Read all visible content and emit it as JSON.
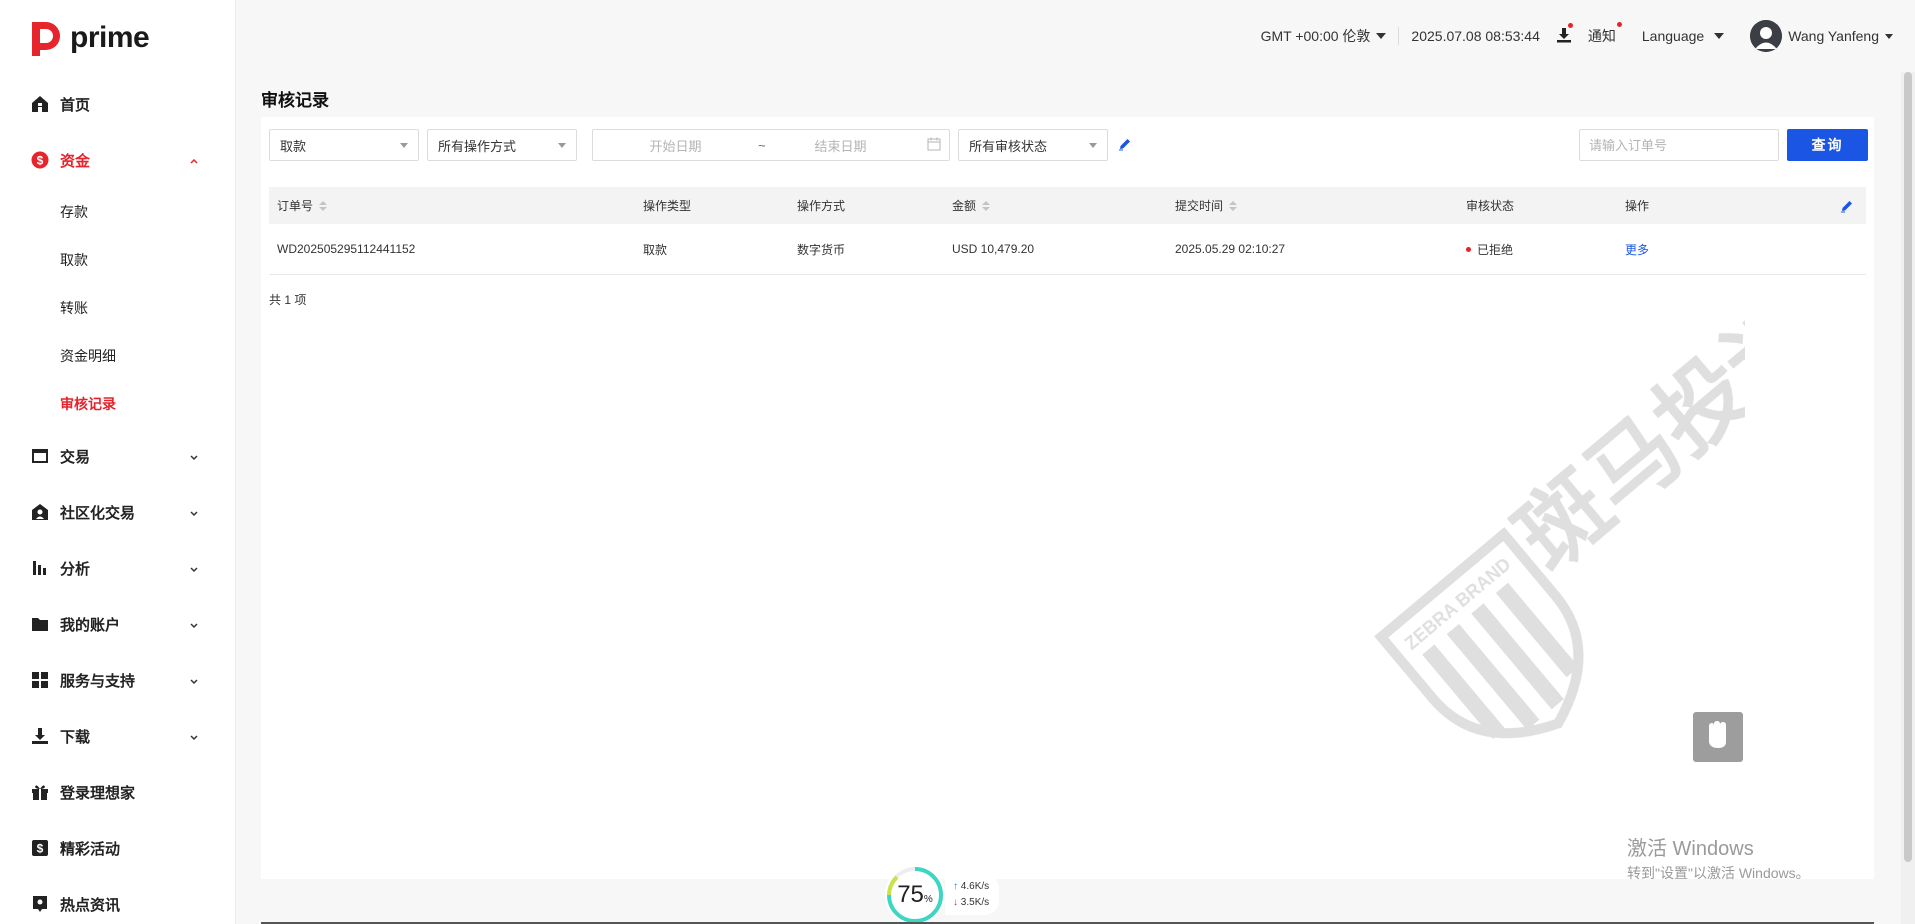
{
  "brand": {
    "name": "prime",
    "accent": "#e5242c",
    "link_color": "#1a55e3"
  },
  "topbar": {
    "timezone": "GMT +00:00 伦敦",
    "datetime": "2025.07.08 08:53:44",
    "notify_label": "通知",
    "language_label": "Language",
    "user_name": "Wang Yanfeng"
  },
  "sidebar": {
    "items": [
      {
        "label": "首页",
        "icon": "home-icon"
      },
      {
        "label": "资金",
        "icon": "dollar-icon",
        "expanded": true,
        "children": [
          {
            "label": "存款"
          },
          {
            "label": "取款"
          },
          {
            "label": "转账"
          },
          {
            "label": "资金明细"
          },
          {
            "label": "审核记录",
            "active": true
          }
        ]
      },
      {
        "label": "交易",
        "icon": "trade-icon"
      },
      {
        "label": "社区化交易",
        "icon": "community-icon"
      },
      {
        "label": "分析",
        "icon": "analysis-icon"
      },
      {
        "label": "我的账户",
        "icon": "folder-icon"
      },
      {
        "label": "服务与支持",
        "icon": "grid-icon"
      },
      {
        "label": "下载",
        "icon": "download-icon"
      },
      {
        "label": "登录理想家",
        "icon": "gift-icon"
      },
      {
        "label": "精彩活动",
        "icon": "event-icon"
      },
      {
        "label": "热点资讯",
        "icon": "news-icon"
      }
    ]
  },
  "page": {
    "title": "审核记录"
  },
  "filters": {
    "type_value": "取款",
    "method_value": "所有操作方式",
    "start_placeholder": "开始日期",
    "range_sep": "~",
    "end_placeholder": "结束日期",
    "status_value": "所有审核状态",
    "order_placeholder": "请输入订单号",
    "query_label": "查询"
  },
  "table": {
    "headers": {
      "order_no": "订单号",
      "op_type": "操作类型",
      "op_method": "操作方式",
      "amount": "金额",
      "submit_time": "提交时间",
      "status": "审核状态",
      "action": "操作"
    },
    "rows": [
      {
        "order_no": "WD202505295112441152",
        "op_type": "取款",
        "op_method": "数字货币",
        "amount": "USD 10,479.20",
        "submit_time": "2025.05.29 02:10:27",
        "status": "已拒绝",
        "action": "更多"
      }
    ],
    "total": "共 1 项"
  },
  "watermark": {
    "text": "斑马投诉",
    "badge_text": "ZEBRA BRAND"
  },
  "overlay": {
    "activate_line1": "激活 Windows",
    "activate_line2": "转到\"设置\"以激活 Windows。",
    "speed_percent": "75",
    "speed_unit": "%",
    "upload_value": "4.6",
    "upload_unit": "K/s",
    "download_value": "3.5",
    "download_unit": "K/s"
  }
}
